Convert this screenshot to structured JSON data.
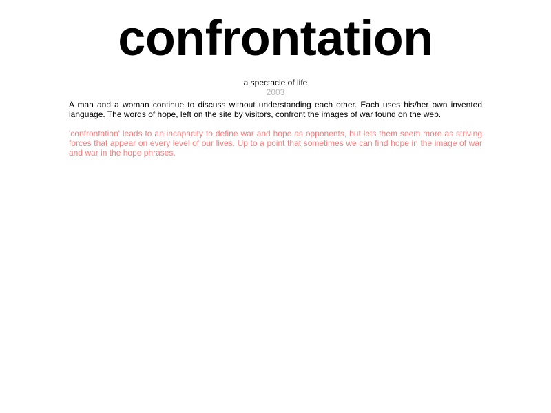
{
  "header": {
    "title": "confrontation",
    "subtitle": "a spectacle of life",
    "year": "2003"
  },
  "content": {
    "description": "A man and a woman continue to discuss without understanding each other. Each uses his/her own invented language. The words of hope, left on the site by visitors, confront the images of war found on the web.",
    "note": "'confrontation' leads to an incapacity to define war and hope as opponents, but lets them seem more as striving forces that appear on every level of our lives. Up to a point that sometimes we can find hope in the image of war and war in the hope phrases."
  },
  "colors": {
    "year": "#b8b8b8",
    "note": "#f08080"
  }
}
